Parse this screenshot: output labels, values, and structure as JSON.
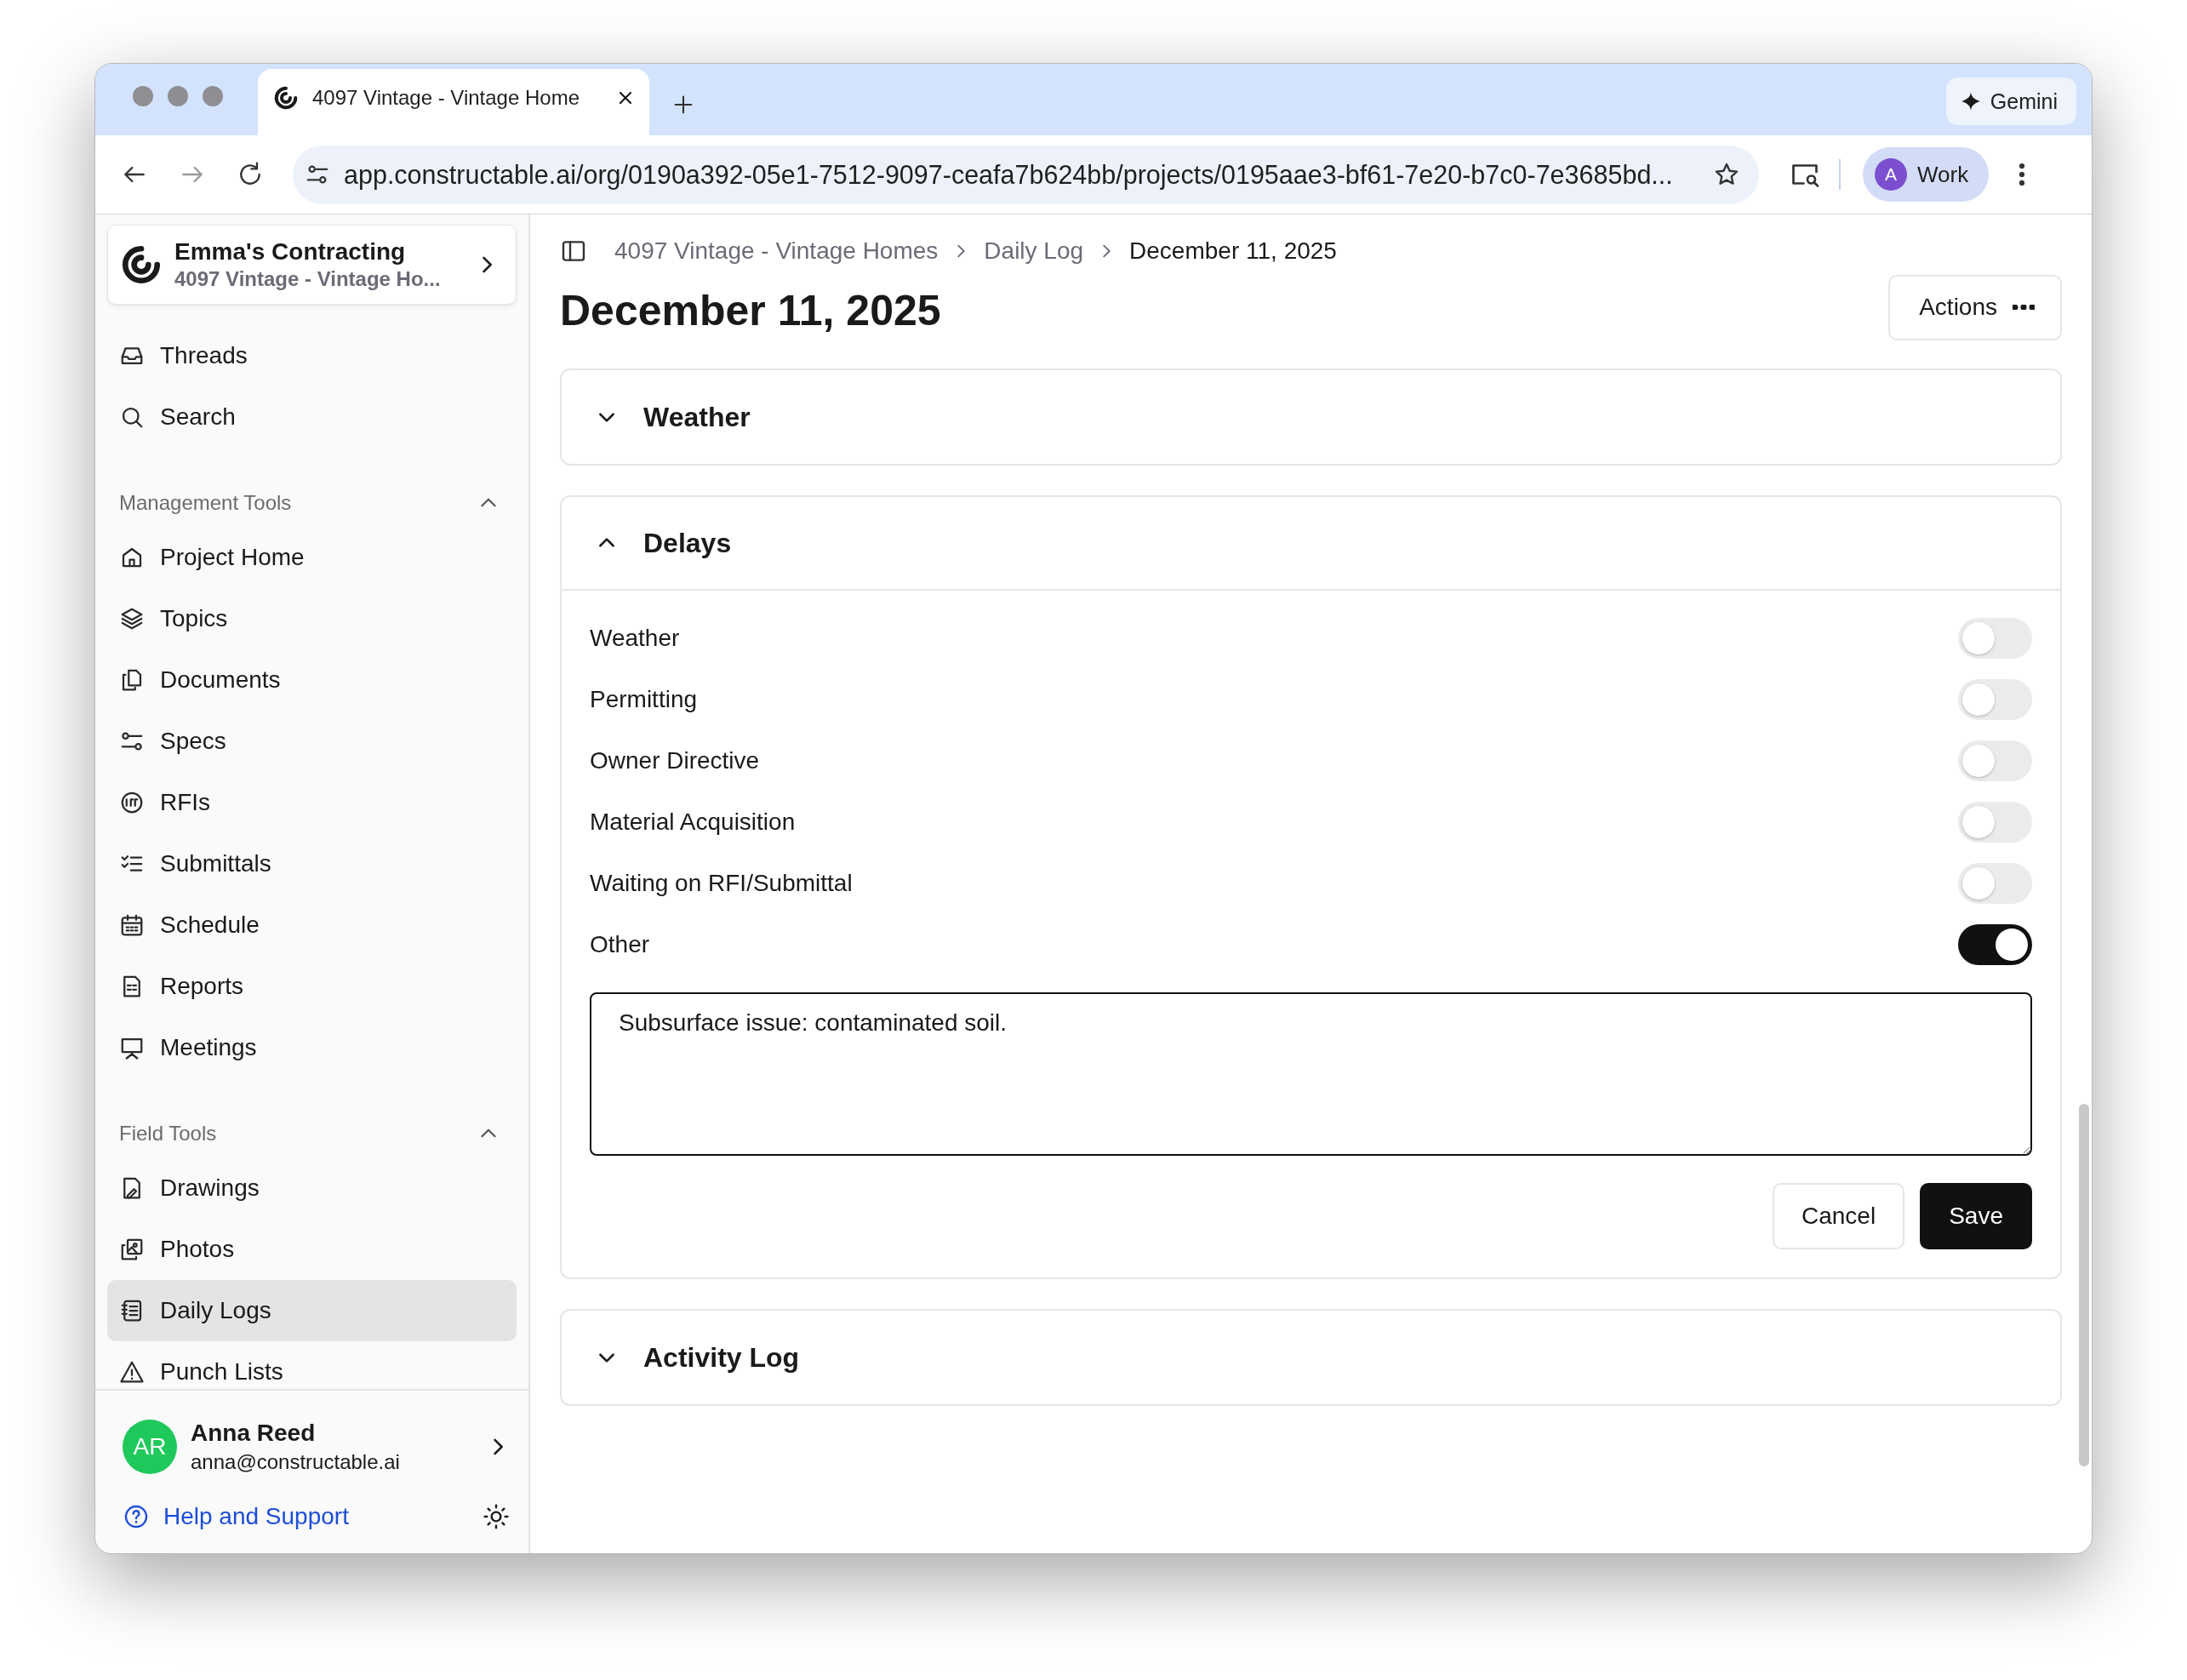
{
  "browser": {
    "tab": {
      "title": "4097 Vintage - Vintage Home"
    },
    "gemini": "Gemini",
    "url": "app.constructable.ai/org/0190a392-05e1-7512-9097-ceafa7b624bb/projects/0195aae3-bf61-7e20-b7c0-7e3685bd...",
    "profile": {
      "initial": "A",
      "label": "Work"
    }
  },
  "sidebar": {
    "org": {
      "name": "Emma's Contracting",
      "project": "4097 Vintage - Vintage Ho..."
    },
    "top_items": [
      {
        "label": "Threads"
      },
      {
        "label": "Search"
      }
    ],
    "sections": [
      {
        "title": "Management Tools",
        "expanded": true,
        "items": [
          {
            "label": "Project Home",
            "selected": false
          },
          {
            "label": "Topics",
            "selected": false
          },
          {
            "label": "Documents",
            "selected": false
          },
          {
            "label": "Specs",
            "selected": false
          },
          {
            "label": "RFIs",
            "selected": false
          },
          {
            "label": "Submittals",
            "selected": false
          },
          {
            "label": "Schedule",
            "selected": false
          },
          {
            "label": "Reports",
            "selected": false
          },
          {
            "label": "Meetings",
            "selected": false
          }
        ]
      },
      {
        "title": "Field Tools",
        "expanded": true,
        "items": [
          {
            "label": "Drawings",
            "selected": false
          },
          {
            "label": "Photos",
            "selected": false
          },
          {
            "label": "Daily Logs",
            "selected": true
          },
          {
            "label": "Punch Lists",
            "selected": false
          }
        ]
      }
    ],
    "user": {
      "initials": "AR",
      "name": "Anna Reed",
      "email": "anna@constructable.ai",
      "color": "#1fc85a"
    },
    "help": "Help and Support"
  },
  "page": {
    "breadcrumb": [
      "4097 Vintage - Vintage Homes",
      "Daily Log",
      "December 11, 2025"
    ],
    "title": "December 11, 2025",
    "actions": "Actions",
    "cards": [
      {
        "title": "Weather",
        "expanded": false
      },
      {
        "title": "Delays",
        "expanded": true,
        "toggles": [
          {
            "label": "Weather",
            "on": false
          },
          {
            "label": "Permitting",
            "on": false
          },
          {
            "label": "Owner Directive",
            "on": false
          },
          {
            "label": "Material Acquisition",
            "on": false
          },
          {
            "label": "Waiting on RFI/Submittal",
            "on": false
          },
          {
            "label": "Other",
            "on": true
          }
        ],
        "note": "Subsurface issue: contaminated soil.",
        "buttons": {
          "cancel": "Cancel",
          "save": "Save"
        }
      },
      {
        "title": "Activity Log",
        "expanded": false
      }
    ]
  }
}
